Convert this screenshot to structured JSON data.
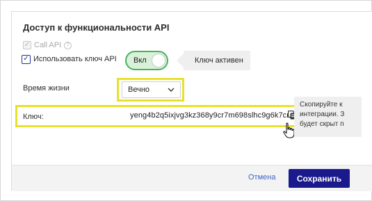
{
  "dialog": {
    "title": "Доступ к функциональности API",
    "call_api": {
      "label": "Call API",
      "checked": true,
      "disabled": true,
      "help_icon": "question-circle-icon",
      "help_glyph": "?"
    },
    "use_key": {
      "label": "Использовать ключ API",
      "checked": true
    },
    "toggle": {
      "label": "Вкл",
      "on": true,
      "color": "#48b25d"
    },
    "status_tooltip": "Ключ активен",
    "lifetime": {
      "label": "Время жизни",
      "value": "Вечно"
    },
    "key": {
      "label": "Ключ:",
      "value": "yeng4b2q5ixjvg3kz368y9cr7m698slhc9g6k7cr",
      "copy_icon": "copy-icon"
    },
    "copy_tooltip": {
      "lines": [
        "Скопируйте к",
        "интеграции. З",
        "будет скрыт п"
      ]
    },
    "footer": {
      "cancel_label": "Отмена",
      "save_label": "Сохранить"
    }
  },
  "colors": {
    "highlight": "#e8e12b",
    "primary": "#1a1a8c",
    "link": "#3f66c4",
    "toggle_bg": "#d9f1d8"
  }
}
